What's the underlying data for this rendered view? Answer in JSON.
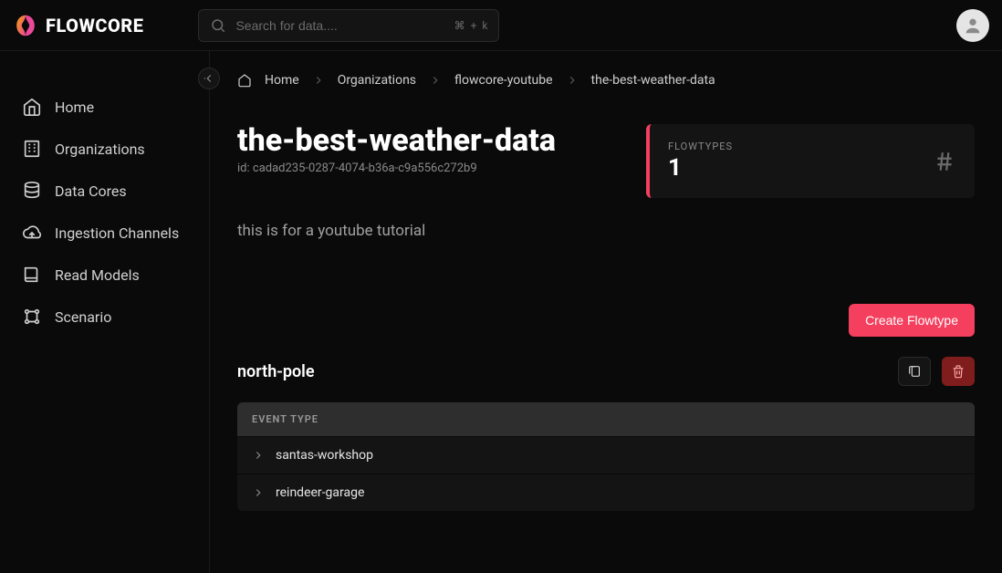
{
  "brand": "FLOWCORE",
  "search": {
    "placeholder": "Search for data....",
    "shortcut_1": "⌘",
    "shortcut_2": "+",
    "shortcut_3": "k"
  },
  "sidebar": {
    "items": [
      {
        "label": "Home"
      },
      {
        "label": "Organizations"
      },
      {
        "label": "Data Cores"
      },
      {
        "label": "Ingestion Channels"
      },
      {
        "label": "Read Models"
      },
      {
        "label": "Scenario"
      }
    ]
  },
  "breadcrumb": {
    "items": [
      "Home",
      "Organizations",
      "flowcore-youtube",
      "the-best-weather-data"
    ]
  },
  "title": "the-best-weather-data",
  "id_label": "id:",
  "id_value": "cadad235-0287-4074-b36a-c9a556c272b9",
  "flowtypes": {
    "label": "FLOWTYPES",
    "count": "1"
  },
  "description": "this is for a youtube tutorial",
  "create_button": "Create Flowtype",
  "flowtype_name": "north-pole",
  "table": {
    "header": "EVENT TYPE",
    "rows": [
      "santas-workshop",
      "reindeer-garage"
    ]
  }
}
